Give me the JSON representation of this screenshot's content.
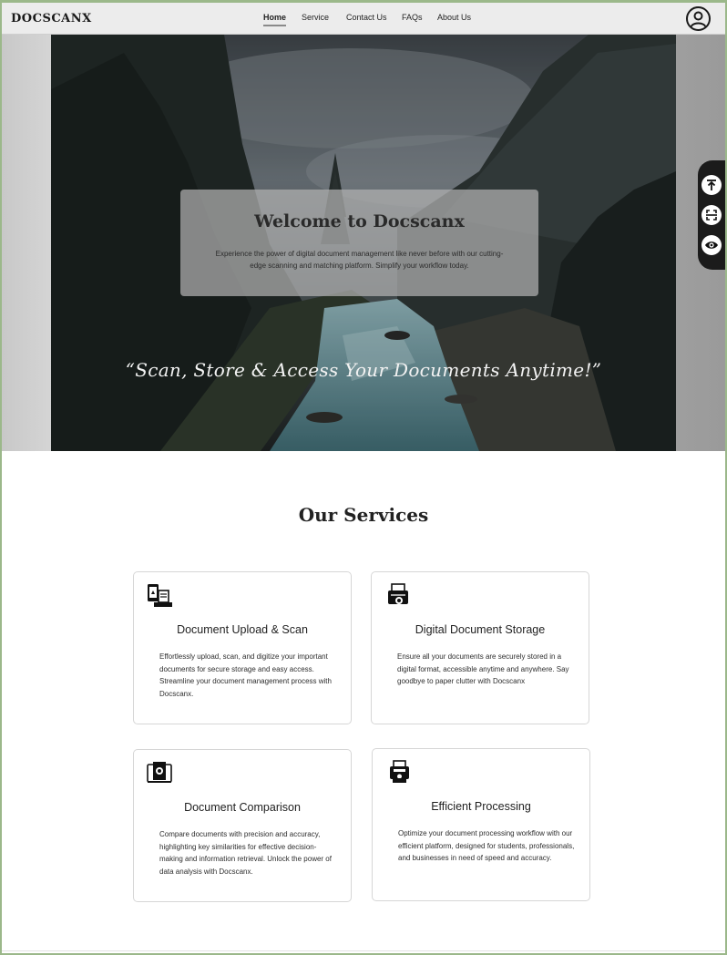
{
  "header": {
    "logo": "DOCSCANX",
    "nav": [
      {
        "label": "Home",
        "active": true
      },
      {
        "label": "Service",
        "active": false
      },
      {
        "label": "Contact Us",
        "active": false
      },
      {
        "label": "FAQs",
        "active": false
      },
      {
        "label": "About Us",
        "active": false
      }
    ],
    "profile_icon": "user-circle-icon"
  },
  "hero": {
    "title": "Welcome to Docscanx",
    "text": "Experience the power of digital document management like never before with our cutting-edge scanning and matching platform. Simplify your workflow today.",
    "tagline": "“Scan, Store & Access Your Documents Anytime!”"
  },
  "side_toolbar": {
    "buttons": [
      {
        "icon": "scroll-to-top-icon"
      },
      {
        "icon": "scan-icon"
      },
      {
        "icon": "eye-icon"
      }
    ]
  },
  "services": {
    "title": "Our Services",
    "cards": [
      {
        "icon": "document-upload-icon",
        "title": "Document Upload & Scan",
        "text": "Effortlessly upload, scan, and digitize your important documents for secure storage and easy access. Streamline your document management process with Docscanx."
      },
      {
        "icon": "document-storage-icon",
        "title": "Digital Document Storage",
        "text": "Ensure all your documents are securely stored in a digital format, accessible anytime and anywhere. Say goodbye to paper clutter with Docscanx"
      },
      {
        "icon": "document-comparison-icon",
        "title": "Document Comparison",
        "text": "Compare documents with precision and accuracy, highlighting key similarities for effective decision-making and information retrieval. Unlock the power of data analysis with Docscanx."
      },
      {
        "icon": "efficient-processing-icon",
        "title": "Efficient Processing",
        "text": "Optimize your document processing workflow with our efficient platform, designed for students, professionals, and businesses in need of speed and accuracy."
      }
    ]
  },
  "colors": {
    "header_bg": "#ececec",
    "frame": "#9bb88a",
    "toolbar_bg": "#1b1b1b"
  }
}
